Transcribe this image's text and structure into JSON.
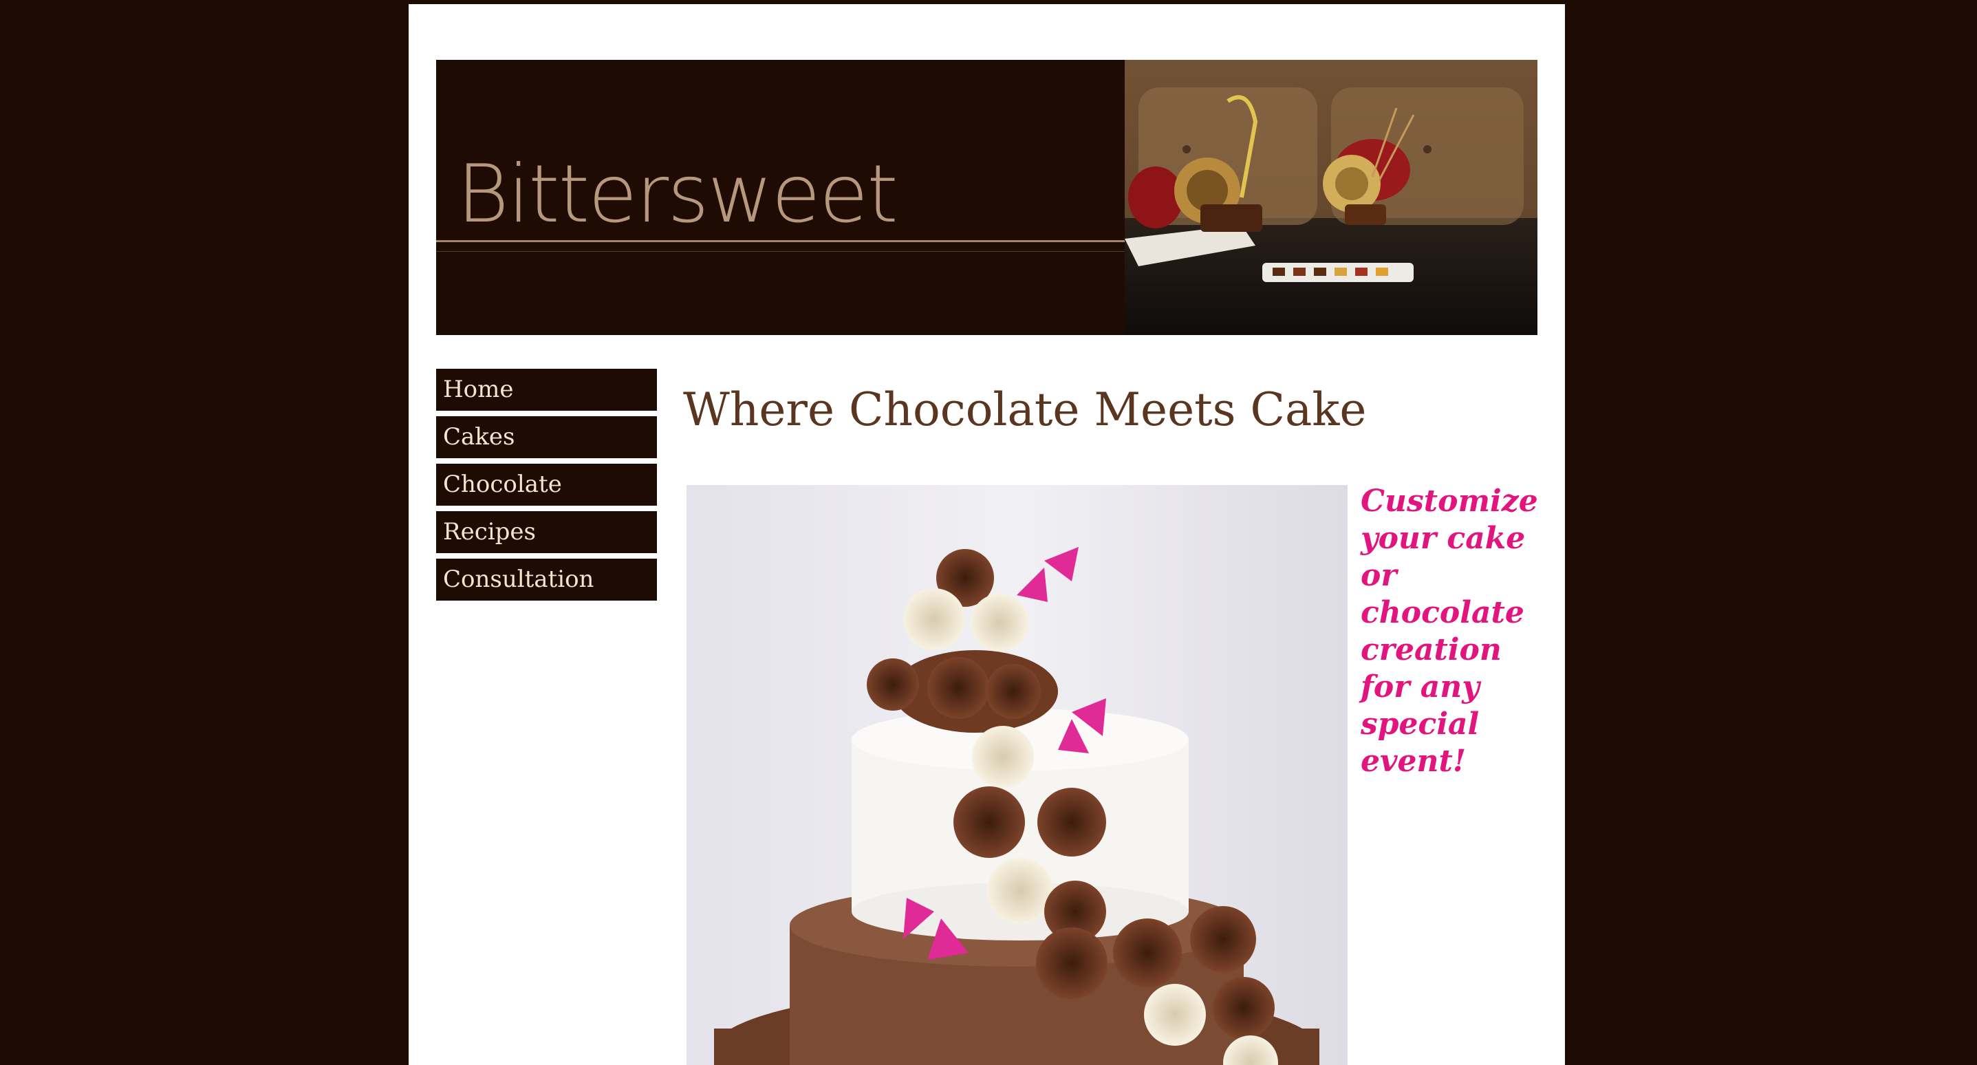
{
  "header": {
    "logo_text": "Bittersweet",
    "photo_icon": "chocolate-dessert-photo"
  },
  "nav": {
    "items": [
      {
        "label": "Home"
      },
      {
        "label": "Cakes"
      },
      {
        "label": "Chocolate"
      },
      {
        "label": "Recipes"
      },
      {
        "label": "Consultation"
      }
    ]
  },
  "main": {
    "title": "Where Chocolate Meets Cake",
    "cake_photo_icon": "chocolate-rose-cake-photo",
    "promo_text": "Customize\nyour cake\nor\nchocolate\ncreation\nfor any\nspecial\nevent!"
  },
  "colors": {
    "background": "#1d0b03",
    "nav_bg": "#1e0b03",
    "nav_text": "#f3e6cf",
    "title": "#5a3520",
    "promo": "#e2147e"
  }
}
